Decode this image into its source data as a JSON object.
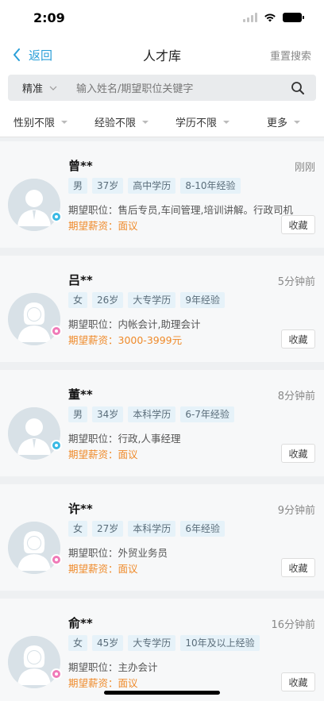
{
  "status": {
    "time": "2:09"
  },
  "nav": {
    "back": "返回",
    "title": "人才库",
    "reset": "重置搜索"
  },
  "search": {
    "mode": "精准",
    "placeholder": "输入姓名/期望职位关键字"
  },
  "filters": [
    "性别不限",
    "经验不限",
    "学历不限",
    "更多"
  ],
  "candidates": [
    {
      "name": "曾**",
      "time": "刚刚",
      "gender": "male",
      "tags": [
        "男",
        "37岁",
        "高中学历",
        "8-10年经验"
      ],
      "position": "期望职位：售后专员,车间管理,培训讲解。行政司机",
      "salary": "期望薪资：面议",
      "fav": "收藏"
    },
    {
      "name": "吕**",
      "time": "5分钟前",
      "gender": "female",
      "tags": [
        "女",
        "26岁",
        "大专学历",
        "9年经验"
      ],
      "position": "期望职位：内帐会计,助理会计",
      "salary": "期望薪资：3000-3999元",
      "fav": "收藏"
    },
    {
      "name": "董**",
      "time": "8分钟前",
      "gender": "male",
      "tags": [
        "男",
        "34岁",
        "本科学历",
        "6-7年经验"
      ],
      "position": "期望职位：行政,人事经理",
      "salary": "期望薪资：面议",
      "fav": "收藏"
    },
    {
      "name": "许**",
      "time": "9分钟前",
      "gender": "female",
      "tags": [
        "女",
        "27岁",
        "本科学历",
        "6年经验"
      ],
      "position": "期望职位：外贸业务员",
      "salary": "期望薪资：面议",
      "fav": "收藏"
    },
    {
      "name": "俞**",
      "time": "16分钟前",
      "gender": "female",
      "tags": [
        "女",
        "45岁",
        "大专学历",
        "10年及以上经验"
      ],
      "position": "期望职位：主办会计",
      "salary": "期望薪资：面议",
      "fav": "收藏"
    }
  ],
  "colors": {
    "accent": "#2a9fd8",
    "salary": "#ef8a2a",
    "male": "#39b9e4",
    "female": "#f07ab8"
  }
}
